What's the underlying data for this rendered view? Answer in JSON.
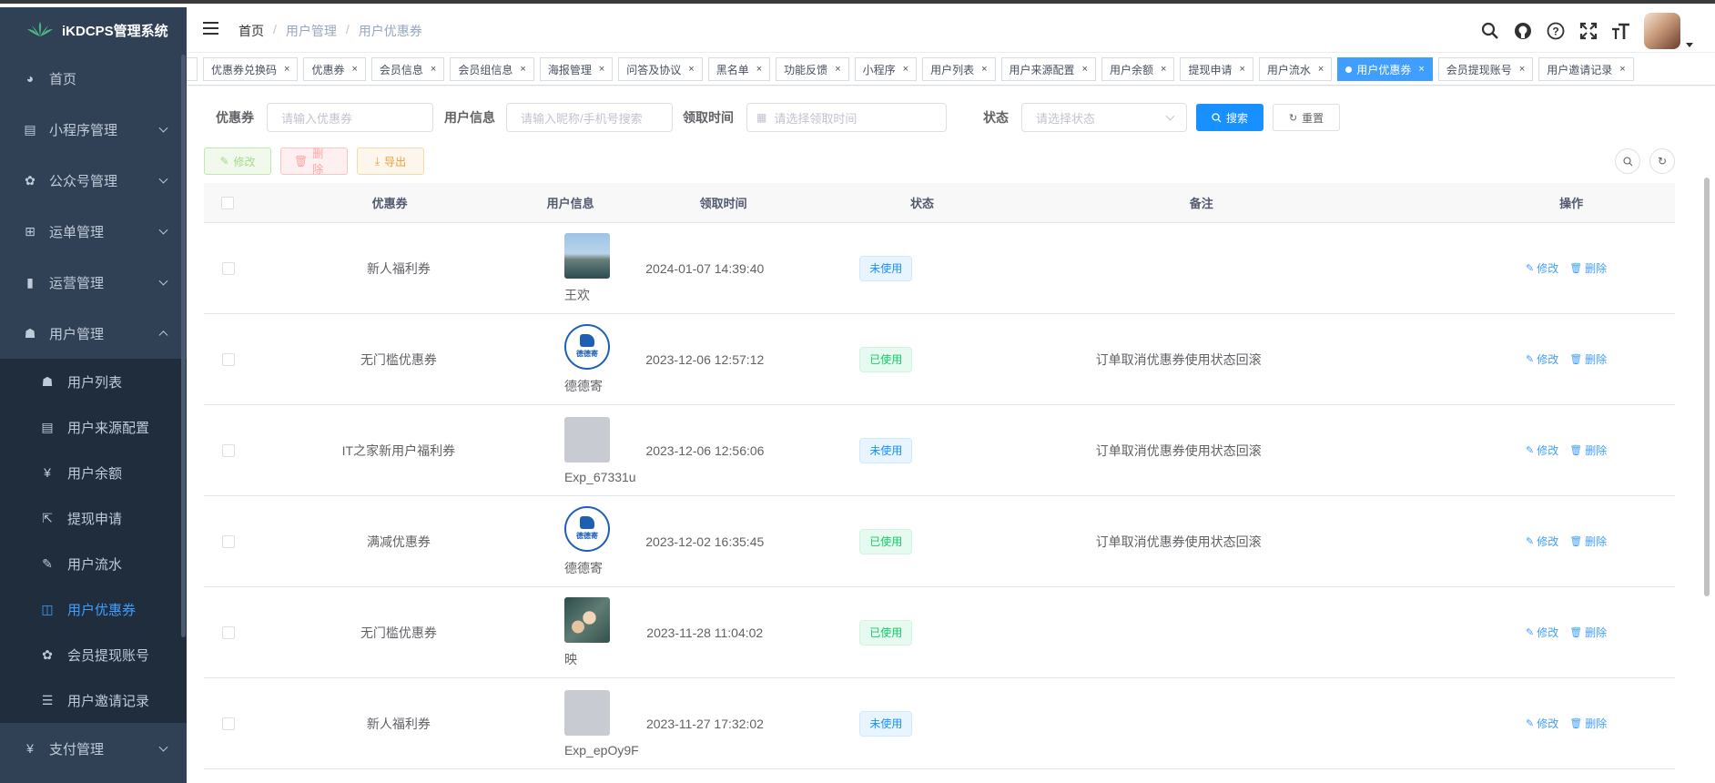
{
  "app": {
    "title": "iKDCPS管理系统"
  },
  "sidebar": {
    "items": [
      {
        "label": "首页",
        "icon": "dashboard-icon",
        "glyph": "◕",
        "expandable": false
      },
      {
        "label": "小程序管理",
        "icon": "miniprogram-icon",
        "glyph": "▤",
        "expandable": true
      },
      {
        "label": "公众号管理",
        "icon": "wechat-icon",
        "glyph": "✿",
        "expandable": true
      },
      {
        "label": "运单管理",
        "icon": "table-icon",
        "glyph": "⊞",
        "expandable": true
      },
      {
        "label": "运营管理",
        "icon": "chart-icon",
        "glyph": "▮",
        "expandable": true
      },
      {
        "label": "用户管理",
        "icon": "user-icon",
        "glyph": "☗",
        "expandable": true,
        "open": true
      },
      {
        "label": "支付管理",
        "icon": "yen-icon",
        "glyph": "¥",
        "expandable": true
      }
    ],
    "sub_items": [
      {
        "label": "用户列表",
        "icon": "user-list-icon",
        "glyph": "☗"
      },
      {
        "label": "用户来源配置",
        "icon": "config-icon",
        "glyph": "▤"
      },
      {
        "label": "用户余额",
        "icon": "yen-icon",
        "glyph": "¥"
      },
      {
        "label": "提现申请",
        "icon": "external-link-icon",
        "glyph": "⇱"
      },
      {
        "label": "用户流水",
        "icon": "edit-icon",
        "glyph": "✎"
      },
      {
        "label": "用户优惠券",
        "icon": "book-icon",
        "glyph": "◫",
        "active": true
      },
      {
        "label": "会员提现账号",
        "icon": "wechat-icon",
        "glyph": "✿"
      },
      {
        "label": "用户邀请记录",
        "icon": "list-icon",
        "glyph": "☰"
      }
    ]
  },
  "header": {
    "breadcrumb": {
      "home": "首页",
      "sep": "/",
      "parent": "用户管理",
      "current": "用户优惠券"
    },
    "tools": [
      "search-icon",
      "github-icon",
      "help-icon",
      "fullscreen-icon",
      "font-size-icon"
    ],
    "tool_glyphs": {
      "search": "⚲",
      "github": "◉",
      "help": "?",
      "fullscreen": "⤢",
      "font": "T"
    }
  },
  "tags": [
    {
      "label": "优惠券兑换码"
    },
    {
      "label": "优惠券"
    },
    {
      "label": "会员信息"
    },
    {
      "label": "会员组信息"
    },
    {
      "label": "海报管理"
    },
    {
      "label": "问答及协议"
    },
    {
      "label": "黑名单"
    },
    {
      "label": "功能反馈"
    },
    {
      "label": "小程序"
    },
    {
      "label": "用户列表"
    },
    {
      "label": "用户来源配置"
    },
    {
      "label": "用户余额"
    },
    {
      "label": "提现申请"
    },
    {
      "label": "用户流水"
    },
    {
      "label": "用户优惠券",
      "active": true
    },
    {
      "label": "会员提现账号"
    },
    {
      "label": "用户邀请记录"
    }
  ],
  "tag_close": "×",
  "search": {
    "coupon_label": "优惠券",
    "coupon_placeholder": "请输入优惠券",
    "user_label": "用户信息",
    "user_placeholder": "请输入昵称/手机号搜索",
    "time_label": "领取时间",
    "time_placeholder": "请选择领取时间",
    "status_label": "状态",
    "status_placeholder": "请选择状态",
    "search_btn": "搜索",
    "reset_btn": "重置"
  },
  "toolbar": {
    "edit": "修改",
    "delete": "删除",
    "export": "导出"
  },
  "table": {
    "columns": [
      "优惠券",
      "用户信息",
      "领取时间",
      "状态",
      "备注",
      "操作"
    ],
    "rows": [
      {
        "coupon": "新人福利券",
        "user": "王欢",
        "avatar": "photo-lake",
        "time": "2024-01-07 14:39:40",
        "status": "未使用",
        "status_type": "unused",
        "note": ""
      },
      {
        "coupon": "无门槛优惠券",
        "user": "德德寄",
        "avatar": "logo-dedeji",
        "time": "2023-12-06 12:57:12",
        "status": "已使用",
        "status_type": "used",
        "note": "订单取消优惠券使用状态回滚"
      },
      {
        "coupon": "IT之家新用户福利券",
        "user": "Exp_67331u",
        "avatar": "placeholder-gray",
        "time": "2023-12-06 12:56:06",
        "status": "未使用",
        "status_type": "unused",
        "note": "订单取消优惠券使用状态回滚"
      },
      {
        "coupon": "满减优惠券",
        "user": "德德寄",
        "avatar": "logo-dedeji",
        "time": "2023-12-02 16:35:45",
        "status": "已使用",
        "status_type": "used",
        "note": "订单取消优惠券使用状态回滚"
      },
      {
        "coupon": "无门槛优惠券",
        "user": "映",
        "avatar": "photo-flowers",
        "time": "2023-11-28 11:04:02",
        "status": "已使用",
        "status_type": "used",
        "note": ""
      },
      {
        "coupon": "新人福利券",
        "user": "Exp_epOy9F",
        "avatar": "placeholder-gray",
        "time": "2023-11-27 17:32:02",
        "status": "未使用",
        "status_type": "unused",
        "note": ""
      }
    ],
    "op_edit": "修改",
    "op_delete": "删除",
    "avatar_logo_text": "德德寄"
  },
  "colors": {
    "sidebar_bg": "#304156",
    "submenu_bg": "#1f2d3d",
    "active": "#409eff",
    "primary": "#1890ff"
  }
}
